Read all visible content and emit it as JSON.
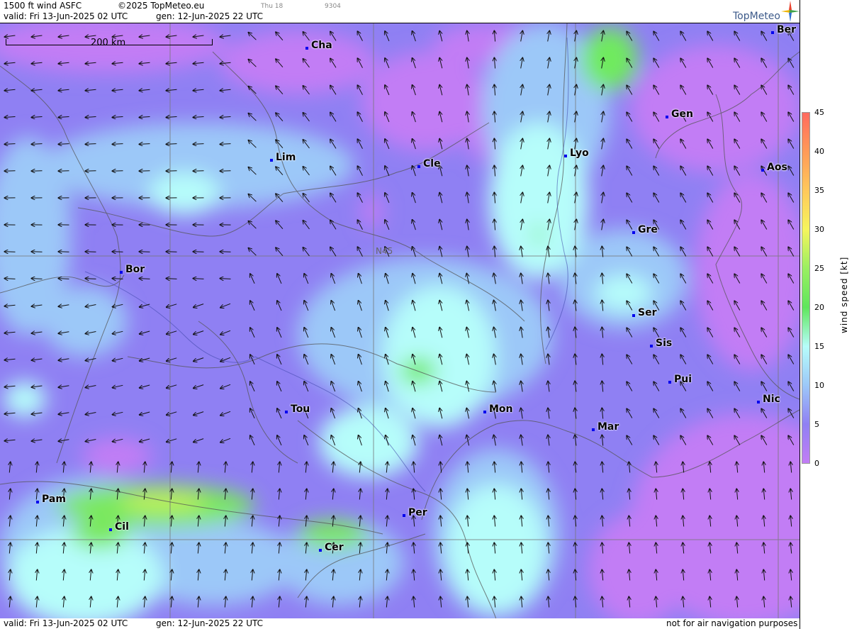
{
  "header": {
    "title": "1500 ft wind ASFC",
    "copyright": "©2025 TopMeteo.eu",
    "valid": "valid:  Fri  13-Jun-2025  02 UTC",
    "gen": "gen: 12-Jun-2025 22 UTC",
    "day": "Thu 18",
    "code": "9304",
    "brand": "TopMeteo"
  },
  "footer": {
    "valid": "valid:  Fri  13-Jun-2025  02 UTC",
    "gen": "gen: 12-Jun-2025 22 UTC",
    "disclaimer": "not for air navigation purposes"
  },
  "scale": {
    "label": "200 km"
  },
  "latitude_label": "N45",
  "legend": {
    "unit": "wind speed [kt]",
    "ticks": [
      "45",
      "40",
      "35",
      "30",
      "25",
      "20",
      "15",
      "10",
      "5",
      "0"
    ],
    "colors": [
      "#ff6a5e",
      "#ff9a58",
      "#ffc85a",
      "#f5f55c",
      "#9aef60",
      "#5fe65c",
      "#b6fdfa",
      "#9cc8f8",
      "#8f80f3",
      "#c27df5"
    ]
  },
  "cities": [
    {
      "name": "Cha"
    },
    {
      "name": "Ber"
    },
    {
      "name": "Lim"
    },
    {
      "name": "Cle"
    },
    {
      "name": "Lyo"
    },
    {
      "name": "Gen"
    },
    {
      "name": "Aos"
    },
    {
      "name": "Gre"
    },
    {
      "name": "Bor"
    },
    {
      "name": "Ser"
    },
    {
      "name": "Sis"
    },
    {
      "name": "Pui"
    },
    {
      "name": "Nic"
    },
    {
      "name": "Tou"
    },
    {
      "name": "Mon"
    },
    {
      "name": "Mar"
    },
    {
      "name": "Pam"
    },
    {
      "name": "Per"
    },
    {
      "name": "Cil"
    },
    {
      "name": "Cer"
    }
  ]
}
